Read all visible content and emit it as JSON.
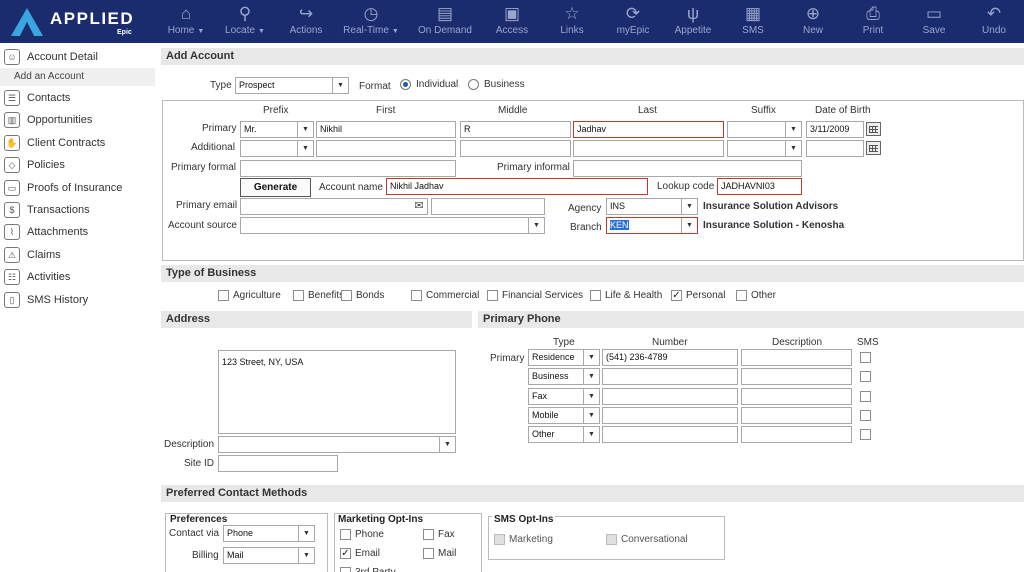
{
  "brand": {
    "name": "APPLIED",
    "sub": "Epic"
  },
  "toolbar": [
    {
      "icon": "home-icon",
      "glyph": "⌂",
      "label": "Home",
      "caret": true
    },
    {
      "icon": "search-icon",
      "glyph": "⚲",
      "label": "Locate",
      "caret": true
    },
    {
      "icon": "actions-icon",
      "glyph": "↪",
      "label": "Actions",
      "caret": false
    },
    {
      "icon": "clock-icon",
      "glyph": "◷",
      "label": "Real-Time",
      "caret": true
    },
    {
      "icon": "on-demand-icon",
      "glyph": "▤",
      "label": "On Demand",
      "caret": false
    },
    {
      "icon": "access-icon",
      "glyph": "▣",
      "label": "Access",
      "caret": false
    },
    {
      "icon": "star-icon",
      "glyph": "☆",
      "label": "Links",
      "caret": false
    },
    {
      "icon": "refresh-icon",
      "glyph": "⟳",
      "label": "myEpic",
      "caret": false
    },
    {
      "icon": "utensils-icon",
      "glyph": "ψ",
      "label": "Appetite",
      "caret": false
    },
    {
      "icon": "sms-icon",
      "glyph": "▦",
      "label": "SMS",
      "caret": false
    },
    {
      "icon": "plus-circle-icon",
      "glyph": "⊕",
      "label": "New",
      "caret": false
    },
    {
      "icon": "printer-icon",
      "glyph": "⎙",
      "label": "Print",
      "caret": false
    },
    {
      "icon": "save-icon",
      "glyph": "▭",
      "label": "Save",
      "caret": false
    },
    {
      "icon": "undo-icon",
      "glyph": "↶",
      "label": "Undo",
      "caret": false
    }
  ],
  "sidebar": {
    "account_detail": "Account Detail",
    "add_account": "Add an Account",
    "items": [
      {
        "icon": "contacts-icon",
        "glyph": "☰",
        "label": "Contacts"
      },
      {
        "icon": "chart-icon",
        "glyph": "▥",
        "label": "Opportunities"
      },
      {
        "icon": "handshake-icon",
        "glyph": "✋",
        "label": "Client Contracts"
      },
      {
        "icon": "shield-icon",
        "glyph": "◇",
        "label": "Policies"
      },
      {
        "icon": "id-card-icon",
        "glyph": "▭",
        "label": "Proofs of Insurance"
      },
      {
        "icon": "dollar-icon",
        "glyph": "$",
        "label": "Transactions"
      },
      {
        "icon": "paperclip-icon",
        "glyph": "⌇",
        "label": "Attachments"
      },
      {
        "icon": "claims-icon",
        "glyph": "⚠",
        "label": "Claims"
      },
      {
        "icon": "activities-icon",
        "glyph": "☷",
        "label": "Activities"
      },
      {
        "icon": "sms-history-icon",
        "glyph": "▯",
        "label": "SMS History"
      }
    ]
  },
  "add_account": {
    "title": "Add Account",
    "type_label": "Type",
    "type_value": "Prospect",
    "format_label": "Format",
    "format_individual": "Individual",
    "format_business": "Business",
    "cols": {
      "prefix": "Prefix",
      "first": "First",
      "middle": "Middle",
      "last": "Last",
      "suffix": "Suffix",
      "dob": "Date of Birth"
    },
    "primary_label": "Primary",
    "additional_label": "Additional",
    "prefix_value": "Mr.",
    "first_value": "Nikhil",
    "middle_value": "R",
    "last_value": "Jadhav",
    "dob_value": "3/11/2009",
    "primary_formal_label": "Primary formal",
    "primary_informal_label": "Primary informal",
    "generate_code": "Generate Code",
    "account_name_label": "Account name",
    "account_name_value": "Nikhil Jadhav",
    "lookup_code_label": "Lookup code",
    "lookup_code_value": "JADHAVNI03",
    "primary_email_label": "Primary email",
    "account_source_label": "Account source",
    "agency_label": "Agency",
    "agency_code": "INS",
    "agency_name": "Insurance Solution Advisors",
    "branch_label": "Branch",
    "branch_code": "KEN",
    "branch_name": "Insurance Solution - Kenosha"
  },
  "type_of_business": {
    "title": "Type of Business",
    "options": [
      {
        "label": "Agriculture",
        "checked": false
      },
      {
        "label": "Benefits",
        "checked": false
      },
      {
        "label": "Bonds",
        "checked": false
      },
      {
        "label": "Commercial",
        "checked": false
      },
      {
        "label": "Financial Services",
        "checked": false
      },
      {
        "label": "Life & Health",
        "checked": false
      },
      {
        "label": "Personal",
        "checked": true
      },
      {
        "label": "Other",
        "checked": false
      }
    ]
  },
  "address": {
    "title": "Address",
    "value": "123 Street, NY, USA",
    "description_label": "Description",
    "site_id_label": "Site ID"
  },
  "primary_phone": {
    "title": "Primary Phone",
    "col_type": "Type",
    "col_number": "Number",
    "col_description": "Description",
    "col_sms": "SMS",
    "primary_label": "Primary",
    "rows": [
      {
        "type": "Residence",
        "number": "(541) 236-4789"
      },
      {
        "type": "Business",
        "number": ""
      },
      {
        "type": "Fax",
        "number": ""
      },
      {
        "type": "Mobile",
        "number": ""
      },
      {
        "type": "Other",
        "number": ""
      }
    ]
  },
  "contact_methods": {
    "title": "Preferred Contact Methods",
    "preferences_title": "Preferences",
    "contact_via_label": "Contact via",
    "contact_via_value": "Phone",
    "billing_label": "Billing",
    "billing_value": "Mail",
    "marketing_title": "Marketing Opt-Ins",
    "marketing": [
      {
        "label": "Phone",
        "checked": false
      },
      {
        "label": "Fax",
        "checked": false
      },
      {
        "label": "Email",
        "checked": true
      },
      {
        "label": "Mail",
        "checked": false
      },
      {
        "label": "3rd Party",
        "checked": false
      }
    ],
    "sms_title": "SMS Opt-Ins",
    "sms": [
      {
        "label": "Marketing"
      },
      {
        "label": "Conversational"
      }
    ]
  }
}
